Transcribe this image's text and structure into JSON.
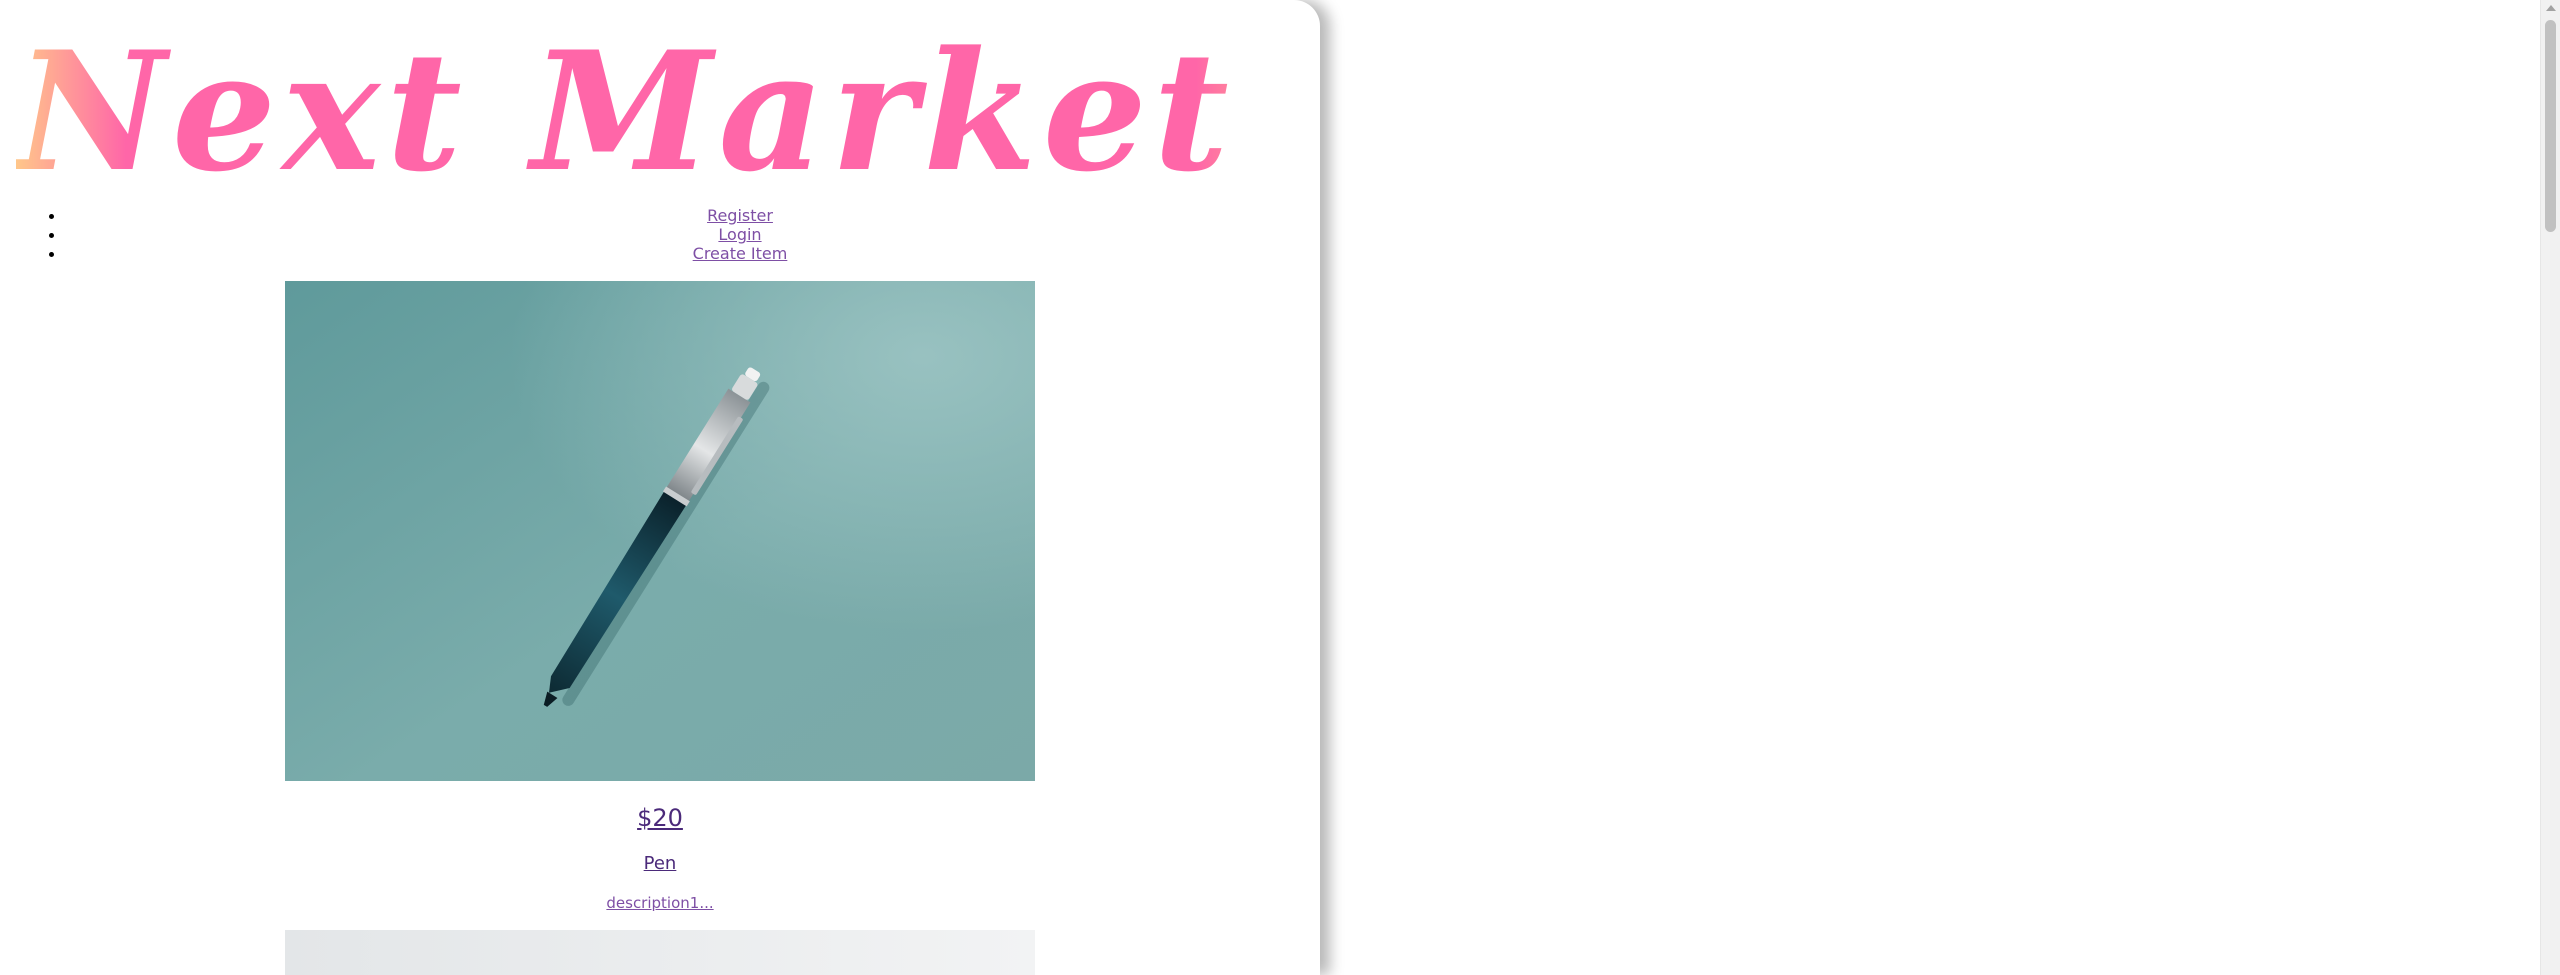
{
  "site": {
    "title": "Next Market"
  },
  "nav": {
    "items": [
      {
        "label": "Register"
      },
      {
        "label": "Login"
      },
      {
        "label": "Create Item"
      }
    ]
  },
  "items": [
    {
      "image": "pen-photo",
      "price": "$20",
      "name": "Pen",
      "description": "description1..."
    },
    {
      "image": "partially-visible-photo"
    }
  ],
  "colors": {
    "logo_main": "#ff66a8",
    "logo_edge": "#ffc78a",
    "link": "#7e4fa5",
    "visited_link": "#4b2a7a",
    "photo_background": "#7fb0b0"
  },
  "scrollbar": {
    "visible": true
  }
}
